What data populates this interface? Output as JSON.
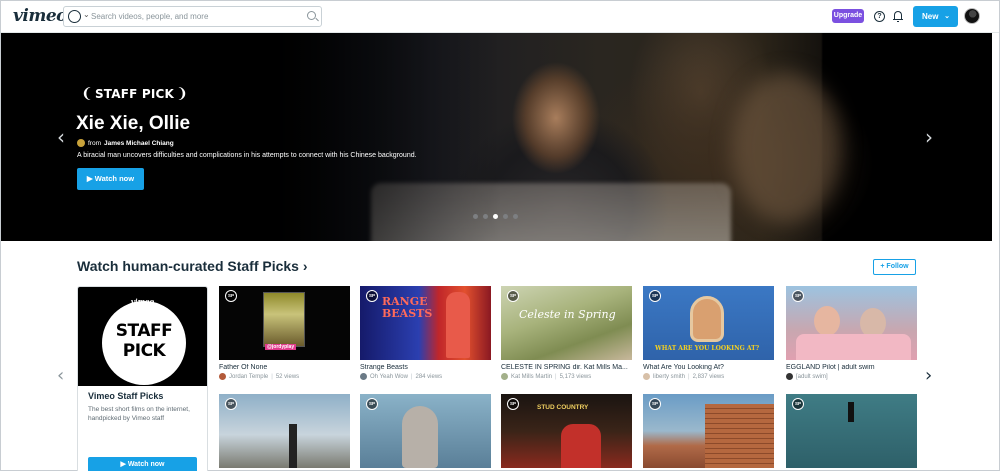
{
  "nav": {
    "logo": "vimeo",
    "search_placeholder": "Search videos, people, and more",
    "upgrade_label": "Upgrade",
    "help_label": "?",
    "new_label": "New"
  },
  "hero": {
    "badge": "STAFF PICK",
    "title": "Xie Xie, Ollie",
    "from_label": "from",
    "author": "James Michael Chiang",
    "description": "A biracial man uncovers difficulties and complications in his attempts to connect with his Chinese background.",
    "watch_label": "▶ Watch now",
    "active_dot": 3,
    "dot_count": 5
  },
  "section": {
    "title": "Watch human-curated Staff Picks ›",
    "follow_label": "+ Follow"
  },
  "staff_pick_card": {
    "logo": "vimeo",
    "badge_line1": "STAFF",
    "badge_line2": "PICK",
    "name": "Vimeo Staff Picks",
    "description": "The best short films on the internet, handpicked by Vimeo staff",
    "watch_label": "▶ Watch now"
  },
  "videos": [
    {
      "title": "Father Of None",
      "author": "Jordan Temple",
      "views": "52 views",
      "thumb_text": "@jordyplay"
    },
    {
      "title": "Strange Beasts",
      "author": "Oh Yeah Wow",
      "views": "284 views",
      "thumb_text": "RANGE BEASTS"
    },
    {
      "title": "CELESTE IN SPRING dir. Kat Mills Ma...",
      "author": "Kat Mills Martin",
      "views": "5,173 views",
      "thumb_text": "Celeste in Spring"
    },
    {
      "title": "What Are You Looking At?",
      "author": "liberty smith",
      "views": "2,837 views",
      "thumb_text": "WHAT ARE YOU LOOKING AT?"
    },
    {
      "title": "EGGLAND Pilot | adult swim",
      "author": "[adult swim]",
      "views": "",
      "thumb_text": ""
    },
    {
      "title": "",
      "author": "",
      "views": "",
      "thumb_text": ""
    },
    {
      "title": "",
      "author": "",
      "views": "",
      "thumb_text": ""
    },
    {
      "title": "",
      "author": "",
      "views": "",
      "thumb_text": "STUD COUNTRY"
    },
    {
      "title": "",
      "author": "",
      "views": "",
      "thumb_text": ""
    },
    {
      "title": "",
      "author": "",
      "views": "",
      "thumb_text": ""
    }
  ],
  "sp_mark": "SP",
  "colors": {
    "accent": "#17a1e6",
    "upgrade": "#7b50e0",
    "text": "#1a2e3b"
  }
}
